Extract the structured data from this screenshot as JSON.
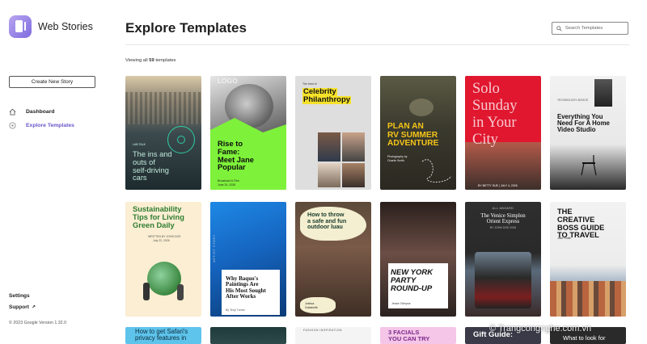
{
  "brand": {
    "name": "Web Stories"
  },
  "sidebar": {
    "create_button": "Create New Story",
    "nav": [
      {
        "label": "Dashboard",
        "icon": "home-icon"
      },
      {
        "label": "Explore Templates",
        "icon": "compass-icon"
      }
    ],
    "settings": "Settings",
    "support": "Support",
    "version": "© 2023 Google Version 1.32.0"
  },
  "header": {
    "title": "Explore Templates",
    "search_placeholder": "Search Templates"
  },
  "summary": {
    "prefix": "Viewing all",
    "count": "59",
    "suffix": "templates"
  },
  "templates": {
    "row1": [
      {
        "lines": [
          "The ins and",
          "outs of",
          "self-driving",
          "cars"
        ],
        "tag": "LAB TALK"
      },
      {
        "logo": "LOGO",
        "lines": [
          "Rise to",
          "Fame:",
          "Meet Jane",
          "Popular"
        ],
        "byline": "Broadcast & Film",
        "date": "June 24, 2026"
      },
      {
        "kicker": "The best of",
        "lines": [
          "Celebrity",
          "Philanthropy"
        ]
      },
      {
        "lines": [
          "PLAN AN",
          "RV SUMMER",
          "ADVENTURE"
        ],
        "byline": "Photography by",
        "author": "Charlie Smith"
      },
      {
        "lines": [
          "Solo",
          "Sunday",
          "in Your",
          "City"
        ],
        "byline": "BY BETTY SUE | JULY 4, 2026"
      },
      {
        "kicker": "TECHNOLOGY ADVICE",
        "lines": [
          "Everything You",
          "Need For A Home",
          "Video Studio"
        ]
      }
    ],
    "row2": [
      {
        "lines": [
          "Sustainability",
          "Tips for Living",
          "Green Daily"
        ],
        "byline": "WRITTEN BY JOHN DOE",
        "date": "July 22, 2026"
      },
      {
        "kicker": "ARTIST STORY",
        "lines": [
          "Why Baquo's",
          "Paintings Are",
          "His Most Sought",
          "After Works"
        ],
        "byline": "By Terry Turner"
      },
      {
        "lines": [
          "How to throw",
          "a safe and fun",
          "outdoor luau"
        ],
        "byline": "Joshua",
        "author": "Goldsmith"
      },
      {
        "lines": [
          "NEW YORK",
          "PARTY",
          "ROUND-UP"
        ],
        "byline": "Jessie Glimpse"
      },
      {
        "kicker": "ALL ABOARD",
        "lines": [
          "The Venice Simplon",
          "Orient Express"
        ],
        "byline": "BY JOHN DOE 2026"
      },
      {
        "lines": [
          "THE",
          "CREATIVE",
          "BOSS GUIDE",
          "TO TRAVEL"
        ],
        "byline": "Jake Smith"
      }
    ],
    "row3": [
      {
        "lines": [
          "How to get Safari's",
          "privacy features in"
        ]
      },
      {
        "lines": []
      },
      {
        "kicker": "FASHION INSPIRATION",
        "lines": []
      },
      {
        "lines": [
          "3 FACIALS",
          "YOU CAN TRY"
        ]
      },
      {
        "lines": [
          "Gift Guide:"
        ]
      },
      {
        "lines": [
          "What to look for"
        ]
      }
    ]
  },
  "watermark": "© Trangcongnghe.com.vn",
  "colors": {
    "accent": "#6b55c9",
    "lime": "#7ef13a",
    "yellow": "#f5e12a",
    "red": "#e0172f",
    "pink": "#f5c6e8"
  }
}
